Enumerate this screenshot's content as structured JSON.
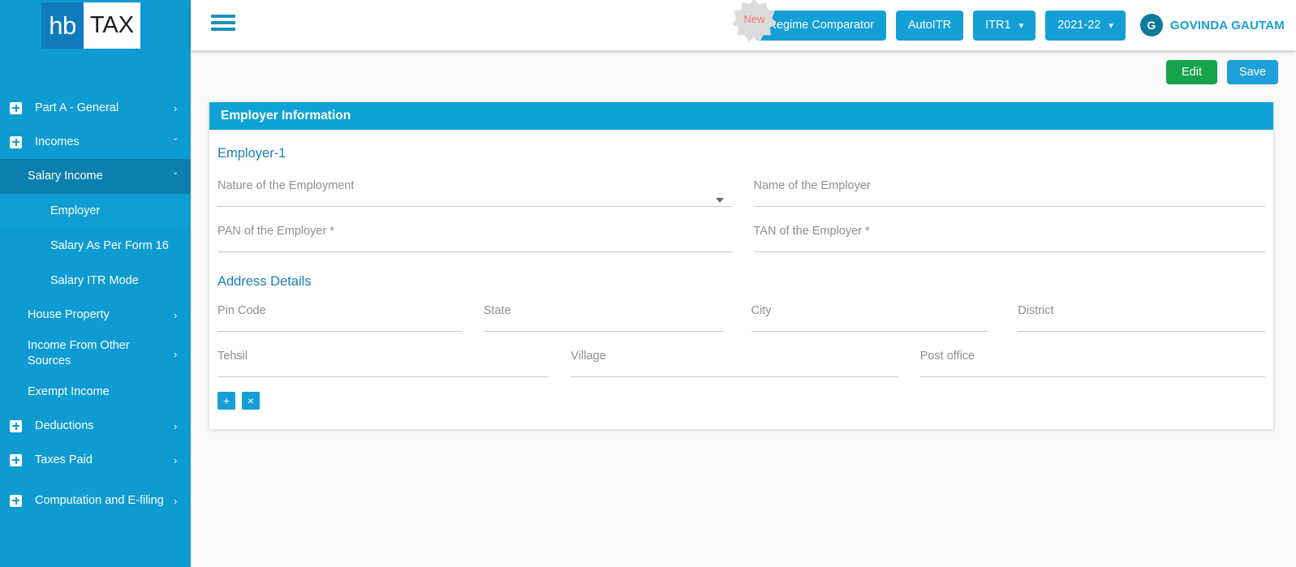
{
  "brand": {
    "logo_primary": "hb",
    "logo_secondary": "TAX",
    "sidebar_color": "#0d9bd2",
    "accent_color": "#149fd6"
  },
  "sidebar": {
    "items": [
      {
        "label": "Part A - General",
        "level": 1,
        "icon": "plus-box-icon",
        "chevron": "›"
      },
      {
        "label": "Incomes",
        "level": 1,
        "icon": "plus-box-icon",
        "chevron": "ˇ"
      },
      {
        "label": "Salary Income",
        "level": 2,
        "chevron": "ˇ",
        "state": "expanded"
      },
      {
        "label": "Employer",
        "level": 3,
        "state": "current"
      },
      {
        "label": "Salary As Per Form 16",
        "level": 3
      },
      {
        "label": "Salary ITR Mode",
        "level": 3
      },
      {
        "label": "House Property",
        "level": 2,
        "chevron": "›"
      },
      {
        "label": "Income From Other Sources",
        "level": 2,
        "chevron": "›"
      },
      {
        "label": "Exempt Income",
        "level": 2
      },
      {
        "label": "Deductions",
        "level": 1,
        "icon": "plus-box-icon",
        "chevron": "›"
      },
      {
        "label": "Taxes Paid",
        "level": 1,
        "icon": "plus-box-icon",
        "chevron": "›"
      },
      {
        "label": "Computation and E-filing",
        "level": 1,
        "icon": "plus-box-icon",
        "chevron": "›"
      }
    ]
  },
  "topbar": {
    "menu_icon": "hamburger-icon",
    "new_badge": "New",
    "regime_comparator": "Regime Comparator",
    "auto_itr": "AutoITR",
    "itr_form": "ITR1",
    "assessment_year": "2021-22",
    "caret": "⌄",
    "user_initial": "G",
    "user_name": "GOVINDA GAUTAM"
  },
  "actions": {
    "edit": "Edit",
    "save": "Save"
  },
  "card": {
    "title": "Employer Information",
    "employer_section": "Employer-1",
    "address_section": "Address Details",
    "fields_row1": [
      {
        "label": "Nature of the Employment",
        "value": "",
        "type": "select"
      },
      {
        "label": "Name of the Employer",
        "value": "",
        "type": "text"
      }
    ],
    "fields_row2": [
      {
        "label": "PAN of the Employer *",
        "value": "",
        "type": "text"
      },
      {
        "label": "TAN of the Employer *",
        "value": "",
        "type": "text"
      }
    ],
    "address_row1": [
      {
        "label": "Pin Code",
        "value": "",
        "type": "text"
      },
      {
        "label": "State",
        "value": "",
        "type": "text"
      },
      {
        "label": "City",
        "value": "",
        "type": "text"
      },
      {
        "label": "District",
        "value": "",
        "type": "text"
      }
    ],
    "address_row2": [
      {
        "label": "Tehsil",
        "value": "",
        "type": "text"
      },
      {
        "label": "Village",
        "value": "",
        "type": "text"
      },
      {
        "label": "Post office",
        "value": "",
        "type": "text"
      }
    ],
    "add_button": "+",
    "remove_button": "×"
  }
}
